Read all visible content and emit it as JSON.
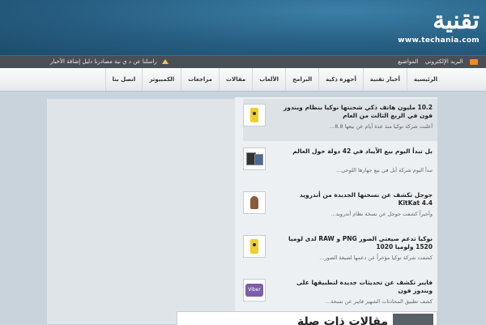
{
  "brand": {
    "logo_text": "تقنية",
    "url": "www.techania.com"
  },
  "topbar": {
    "email": "البريد الإلكتروني",
    "news": "المواضيع",
    "links": "راسلنا عن د ي نية  مصادرنا دليل إضافة الأخبار"
  },
  "nav": {
    "items": [
      "الرئيسية",
      "أخبار تقنية",
      "أجهزة ذكية",
      "البرامج",
      "الألعاب",
      "مقالات",
      "مراجعات",
      "الكمبيوتر",
      "اتصل بنا"
    ]
  },
  "posts": [
    {
      "title": "10.2 مليون هاتف ذكي شحنتها نوكيا بنظام ويندوز فون في الربع الثالث من العام",
      "excerpt": "أعلنت شركة نوكيا منذ عدة أيام عن بيعها 8.8...",
      "thumb": "yellow-phone"
    },
    {
      "title": "بل تبدأ اليوم بيع الآيباد في 42 دولة حول العالم",
      "excerpt": "تبدأ اليوم شركة أبل في بيع جهازها اللوحي...",
      "thumb": "ipad"
    },
    {
      "title": "جوجل تكشف عن نسختها الجديدة من أندرويد KitKat 4.4",
      "excerpt": "وأخيراً كشفت جوجل عن نسخة نظام أندرويد...",
      "thumb": "android"
    },
    {
      "title": "نوكيا تدعم صيغتي الصور PNG و RAW لدى لوميا 1520 ولوميا 1020",
      "excerpt": "كشفت شركة نوكيا مؤخراً عن دعمها لصيغة الصور...",
      "thumb": "yellow-phone"
    },
    {
      "title": "فايبر تكشف عن تحديثات جديدة لتطبيقها على ويندوز فون",
      "excerpt": "كشف تطبيق المحادثات الشهير فايبر عن نسخة...",
      "thumb": "viber"
    }
  ],
  "bottom": {
    "text": "مقالات ذات صلة"
  },
  "colors": {
    "header": "#275e82",
    "topbar": "#4a4f55",
    "rss": "#f08a24"
  }
}
